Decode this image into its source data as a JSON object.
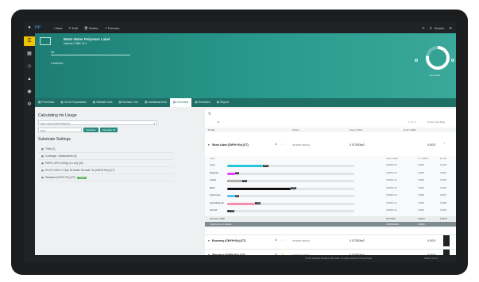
{
  "topbar": {
    "items": [
      "New",
      "Edit",
      "Delete",
      "Preview"
    ],
    "right_label": "Search"
  },
  "hero": {
    "title": "Matte Water Polyester Label",
    "subtitle": "Material 2 MBK 33-3",
    "line2": "Ink",
    "line3": "Adhesive",
    "gauge_label": "Generated"
  },
  "tabs": [
    {
      "label": "Print Data",
      "active": false
    },
    {
      "label": "Ink & Preparation",
      "active": false
    },
    {
      "label": "Variable Inks",
      "active": false
    },
    {
      "label": "Surface / Ink",
      "active": false
    },
    {
      "label": "Additional Inks",
      "active": false
    },
    {
      "label": "Overview",
      "active": true
    },
    {
      "label": "Releases",
      "active": false
    },
    {
      "label": "Report",
      "active": false
    }
  ],
  "left_panel": {
    "title": "Calculating Ink Usage",
    "selector_value": "Short Label (CMYK/Sx)(CT)",
    "qty_placeholder": "Print",
    "buttons": [
      "Calculate",
      "Calculate All"
    ],
    "substrate_title": "Substrate Settings",
    "substrate_items": [
      {
        "label": "Thick (1)",
        "badge": ""
      },
      {
        "label": "Coverage - Hardcoat Ink (4)",
        "badge": ""
      },
      {
        "label": "PAPPC-2PD 1000gr (3 x cm) (32)",
        "badge": ""
      },
      {
        "label": "Pre-P-H 200 +/-Cfxyr Rx Matte Thermal / Dr (CMYK+Sx) (CT)",
        "badge": ""
      },
      {
        "label": "Standard (CMYK+Sx) (CT)",
        "badge": "Default"
      }
    ]
  },
  "right_panel": {
    "filter_label": "All",
    "pager": "1 / 2 / 3",
    "pager_right": "15 Ink Used Page",
    "headers": [
      "Profile",
      "Printer",
      "Area / 100m",
      "Cost / 1000"
    ],
    "group1": {
      "name": "Short Label (CMYK+Sx) (CT)",
      "printer": "HP 6900 C000 (1)",
      "area": "0.077543m2",
      "cost": "0.0474"
    },
    "inner_header": [
      "Color",
      "Area / 1000",
      "% / 1000m",
      "$ / 1M"
    ],
    "inks": [
      {
        "name": "Cyan",
        "pct": 14,
        "color": "#26c6da",
        "area": "0.00000 m2",
        "ratio": "0.0000",
        "cost": "0.1446"
      },
      {
        "name": "Magenta",
        "pct": 3,
        "color": "#e040fb",
        "area": "0.00000 m2",
        "ratio": "0.0000",
        "cost": "0.0004"
      },
      {
        "name": "Yellow",
        "pct": 6,
        "color": "#f5f5f5",
        "area": "0.00000 m2",
        "ratio": "0.0000",
        "cost": "0.0025"
      },
      {
        "name": "Black",
        "pct": 25,
        "color": "#111111",
        "area": "0.00000 m2",
        "ratio": "0.0000",
        "cost": "0.0250"
      },
      {
        "name": "Light Cyan",
        "pct": 3,
        "color": "#4fc3f7",
        "area": "0.00000 m2",
        "ratio": "0.0000",
        "cost": "0.0016"
      },
      {
        "name": "Light Magenta",
        "pct": 11,
        "color": "#f48fb1",
        "area": "0.00000 m2",
        "ratio": "0.0000",
        "cost": "0.0088"
      },
      {
        "name": "Varnish",
        "pct": 1,
        "color": "#222222",
        "area": "0.00000 m2",
        "ratio": "0.0000",
        "cost": "0.0000"
      }
    ],
    "subtotal": {
      "label": "Ink Cost / 1000",
      "area": "0.077543",
      "ratio": "0.0474",
      "cost": "0.0474"
    },
    "total": {
      "label": "Total Cost of 1 Copies",
      "area": "0.000011184",
      "ratio": "0.0000"
    },
    "group2": {
      "name": "Economy (CMYK+Sx) (CT)",
      "printer": "HP 6900 C000 (1)",
      "area": "0.077543m2",
      "cost": "0.0474"
    },
    "group3": {
      "name": "Standard (CMYK+Sx) (CT)",
      "printer": "HP 6900 C000 (1)",
      "area": "0.077543m2",
      "cost": "0.0474"
    },
    "bottom_pager": "1 / 2 / 3",
    "bottom_pager_right": "15 Ink Used Page"
  },
  "footer": {
    "left": "© Print Software Solutions 2024 2019 - All rights reserved / Privacy Policy",
    "right": "Version 1.2.3.4"
  }
}
